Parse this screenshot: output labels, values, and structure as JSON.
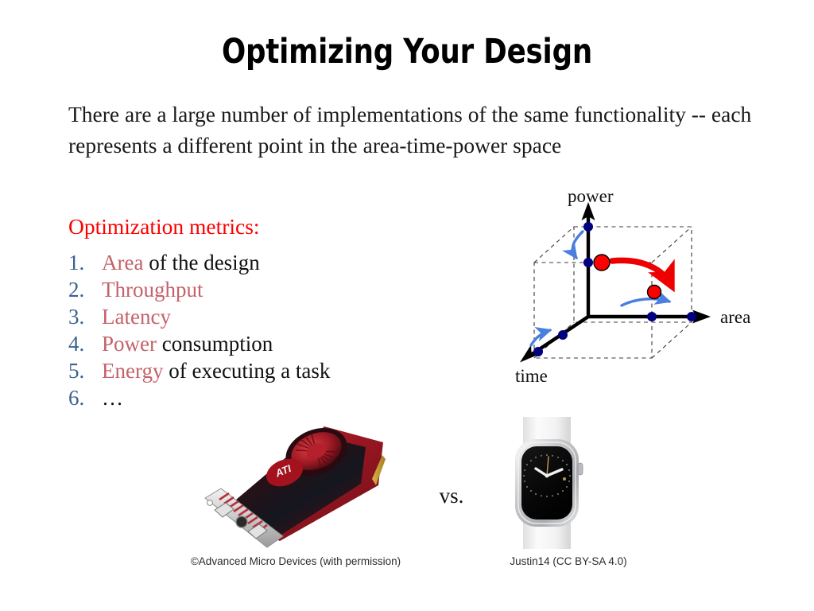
{
  "slide": {
    "title": "Optimizing Your Design",
    "intro": "There are a large number of implementations of the same functionality -- each represents a different point in the area-time-power space",
    "metrics_heading": "Optimization metrics:",
    "vs_label": "vs."
  },
  "metrics": [
    {
      "num": "1.",
      "keyword": "Area",
      "rest": " of the design"
    },
    {
      "num": "2.",
      "keyword": "Throughput",
      "rest": ""
    },
    {
      "num": "3.",
      "keyword": "Latency",
      "rest": ""
    },
    {
      "num": "4.",
      "keyword": "Power",
      "rest": " consumption"
    },
    {
      "num": "5.",
      "keyword": "Energy",
      "rest": " of executing a task"
    },
    {
      "num": "6.",
      "keyword": "",
      "rest": "…"
    }
  ],
  "diagram": {
    "axes": {
      "power": "power",
      "area": "area",
      "time": "time"
    },
    "design_points": 2,
    "colors": {
      "axis": "#000000",
      "cube_edge": "#333333",
      "design_point": "#ff0000",
      "axis_point": "#000080",
      "move_arrow": "#4a7fe0",
      "tradeoff_arrow": "#ee0000"
    }
  },
  "figures": [
    {
      "name": "graphics-card",
      "credit": "©Advanced Micro Devices (with permission)",
      "brand": "ATI"
    },
    {
      "name": "smart-watch",
      "credit": "Justin14 (CC BY-SA 4.0)",
      "brand": ""
    }
  ],
  "colors": {
    "heading_red": "#ff0000",
    "keyword_red": "#c4626a",
    "list_number_blue": "#3a6191",
    "body_text": "#1a1a1a"
  }
}
